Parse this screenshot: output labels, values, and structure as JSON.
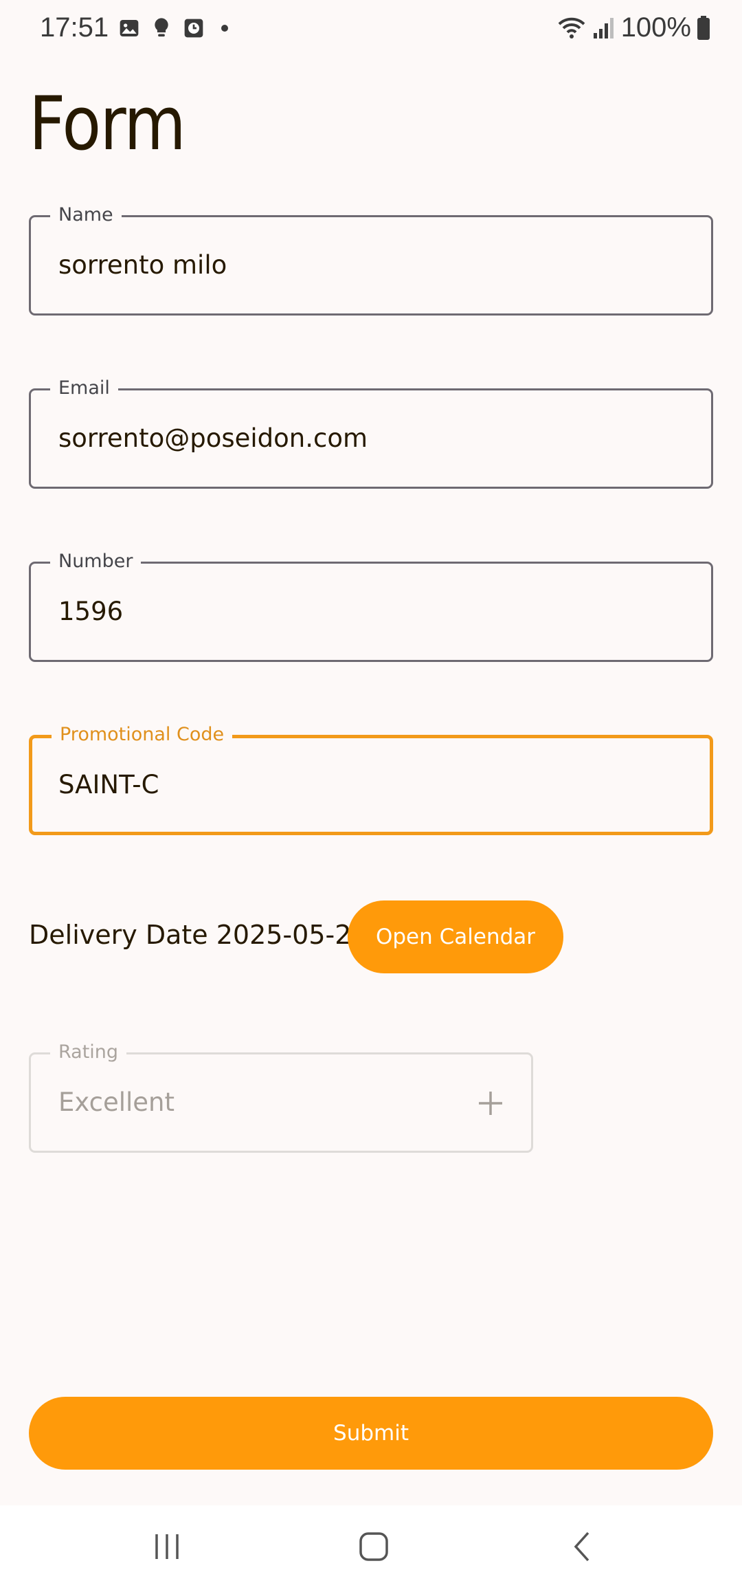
{
  "status_bar": {
    "time": "17:51",
    "notification_icons": [
      "image-icon",
      "lightbulb-icon",
      "clock-icon"
    ],
    "battery_percent": "100%"
  },
  "page": {
    "title": "Form"
  },
  "fields": {
    "name": {
      "label": "Name",
      "value": "sorrento milo"
    },
    "email": {
      "label": "Email",
      "value": "sorrento@poseidon.com"
    },
    "number": {
      "label": "Number",
      "value": "1596"
    },
    "promo": {
      "label": "Promotional Code",
      "value": "SAINT-C"
    },
    "rating": {
      "label": "Rating",
      "value": "Excellent"
    }
  },
  "delivery": {
    "text": "Delivery Date 2025-05-21",
    "calendar_button_label": "Open Calendar"
  },
  "submit_label": "Submit",
  "colors": {
    "accent": "#FF9A0A",
    "focused_border": "#F29A1A",
    "background": "#FDF9F8",
    "text": "#261900"
  }
}
